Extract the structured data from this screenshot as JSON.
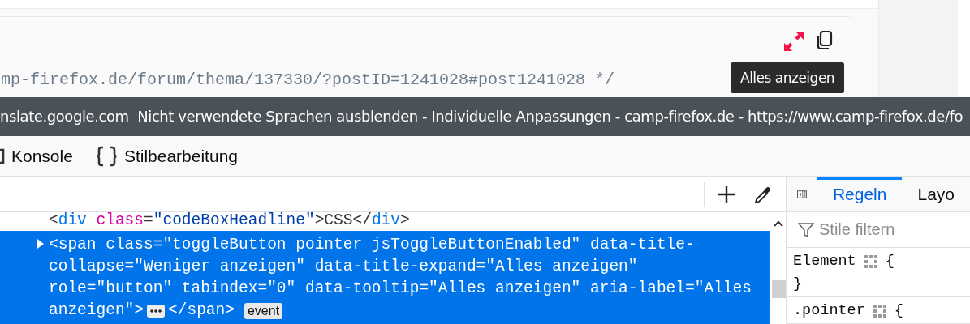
{
  "page": {
    "code_line": "mp-firefox.de/forum/thema/137330/?postID=1241028#post1241028 */",
    "tooltip": "Alles anzeigen"
  },
  "title_tooltip": "nslate.google.com  Nicht verwendete Sprachen ausblenden - Individuelle Anpassungen - camp-firefox.de - https://www.camp-firefox.de/fo",
  "devtools_tabs": [
    {
      "label": "Konsole"
    },
    {
      "label": "Stilbearbeitung"
    }
  ],
  "markup": {
    "nodes": [
      {
        "kind": "plain",
        "selected": false,
        "parts": [
          {
            "kind": "punct",
            "text": "<"
          },
          {
            "kind": "tag",
            "text": "div"
          },
          {
            "kind": "attr",
            "text": " class"
          },
          {
            "kind": "punct",
            "text": "="
          },
          {
            "kind": "value",
            "text": "\"codeBoxHeadline\""
          },
          {
            "kind": "punct",
            "text": ">CSS</"
          },
          {
            "kind": "tag",
            "text": "div"
          },
          {
            "kind": "punct",
            "text": ">"
          }
        ]
      },
      {
        "kind": "element",
        "selected": true,
        "expanded": false,
        "lines": [
          "<span class=\"toggleButton pointer jsToggleButtonEnabled\" data-title-",
          "collapse=\"Weniger anzeigen\" data-title-expand=\"Alles anzeigen\"",
          "role=\"button\" tabindex=\"0\" data-tooltip=\"Alles anzeigen\" aria-label=\"Alles",
          "anzeigen\">"
        ],
        "closing": "</span>",
        "collapsed_content": true,
        "badge": "event"
      }
    ]
  },
  "sidebar": {
    "tabs": [
      {
        "label": "Regeln",
        "selected": true
      },
      {
        "label": "Layo",
        "selected": false
      }
    ],
    "filter": {
      "placeholder": "Stile filtern"
    },
    "rules": [
      {
        "selector": "Element",
        "open": "{",
        "close": "}"
      },
      {
        "selector": ".pointer",
        "open": "{"
      }
    ]
  }
}
